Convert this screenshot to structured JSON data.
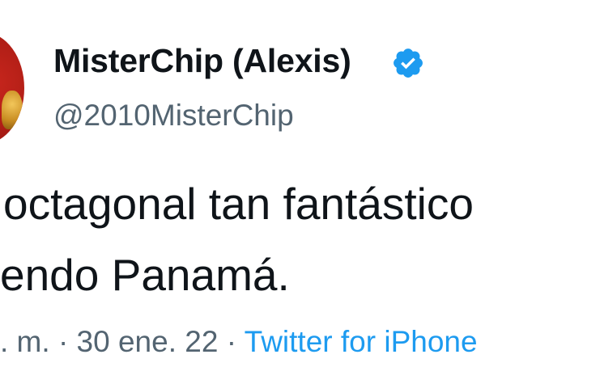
{
  "author": {
    "display_name": "MisterChip (Alexis)",
    "handle": "@2010MisterChip",
    "verified": true,
    "avatar": "trophy-avatar"
  },
  "tweet": {
    "line_1": "octagonal tan fantástico",
    "line_2": "endo Panamá."
  },
  "meta": {
    "time_fragment": ". m. · ",
    "date": "30 ene. 22",
    "separator": " · ",
    "source": "Twitter for iPhone"
  },
  "colors": {
    "primary_text": "#0f1419",
    "secondary_text": "#536471",
    "link": "#1d9bf0",
    "verified_badge": "#1d9bf0"
  },
  "icons": {
    "verified": "verified-badge-icon"
  }
}
